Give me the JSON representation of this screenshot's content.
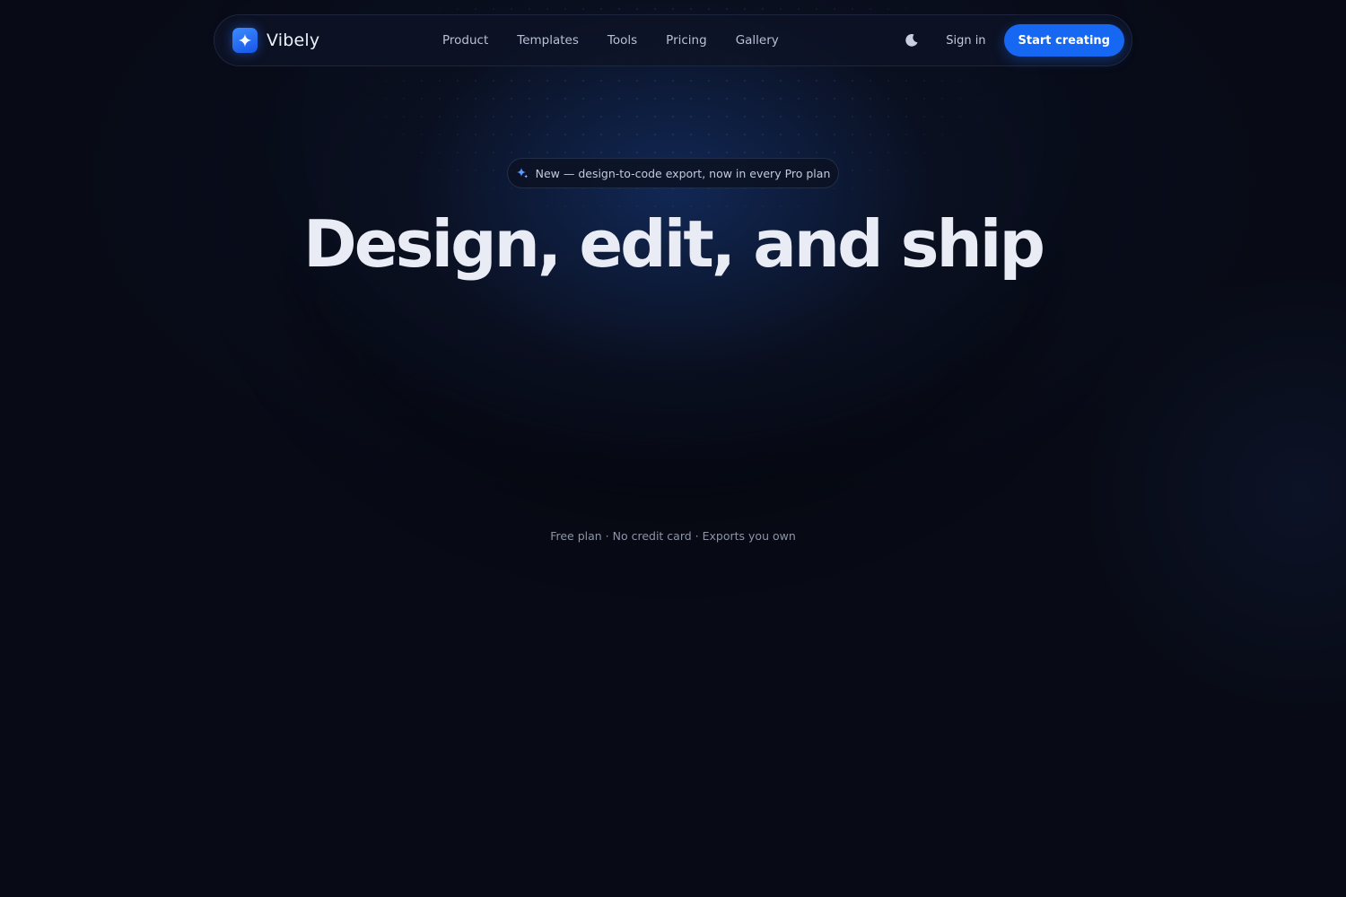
{
  "nav": {
    "brand": "Vibely",
    "links": [
      "Product",
      "Templates",
      "Tools",
      "Pricing",
      "Gallery"
    ],
    "theme_icon": "moon-icon",
    "sign_in": "Sign in",
    "cta": "Start creating"
  },
  "hero": {
    "badge_icon": "sparkle-icon",
    "badge": "New — design-to-code export, now in every Pro plan",
    "headline": "Design, edit, and ship",
    "fineprint": "Free plan · No credit card · Exports you own"
  },
  "colors": {
    "background": "#080b16",
    "accent": "#1668f2",
    "text": "#e9ecf5",
    "muted": "#8d94a8"
  }
}
